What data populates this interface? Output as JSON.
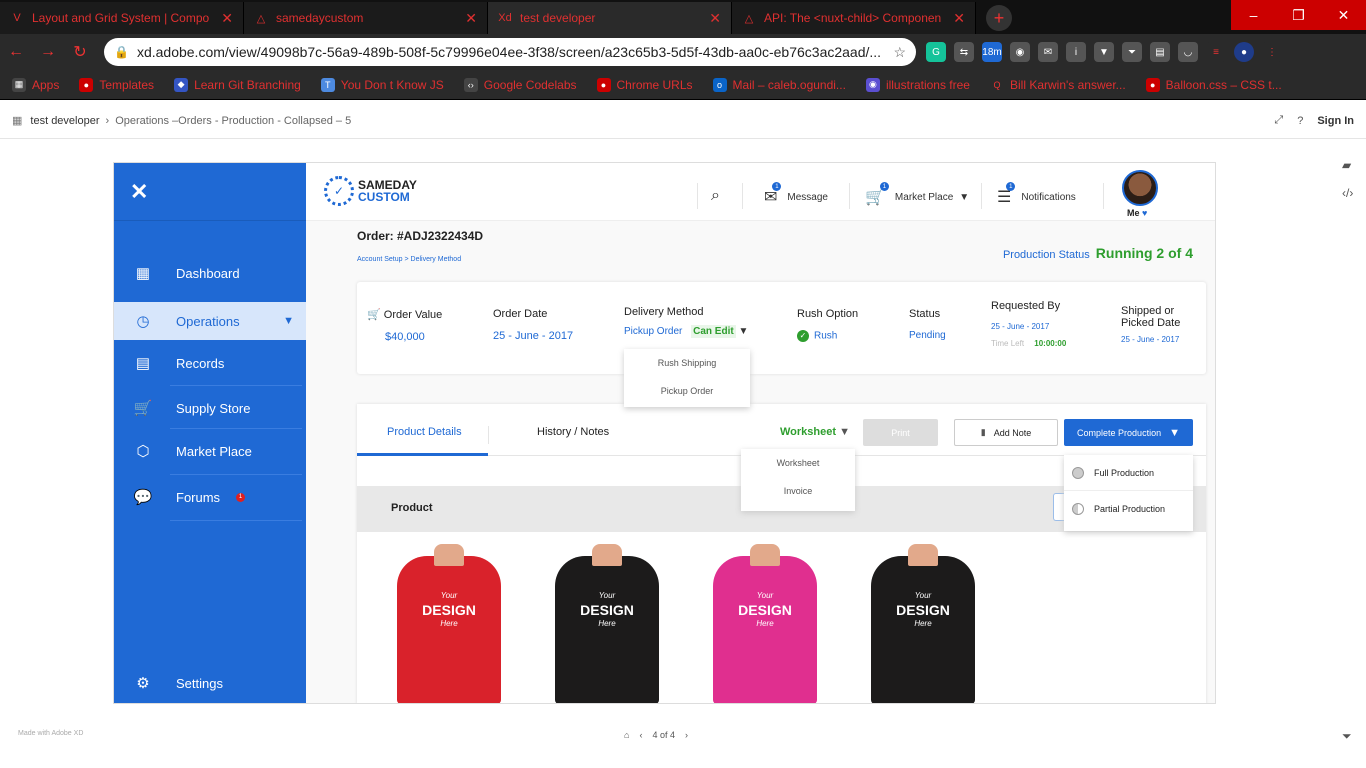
{
  "browser": {
    "tabs": [
      {
        "icon": "V",
        "title": "Layout and Grid System | Compo"
      },
      {
        "icon": "△",
        "title": "samedaycustom"
      },
      {
        "icon": "Xd",
        "title": "test developer"
      },
      {
        "icon": "△",
        "title": "API: The <nuxt-child> Componen"
      }
    ],
    "url": "xd.adobe.com/view/49098b7c-56a9-489b-508f-5c79996e04ee-3f38/screen/a23c65b3-5d5f-43db-aa0c-eb76c3ac2aad/...",
    "ext_badge": "18m",
    "bookmarks": [
      "Apps",
      "Templates",
      "Learn Git Branching",
      "You Don t Know JS",
      "Google Codelabs",
      "Chrome URLs",
      "Mail – caleb.ogundi...",
      "illustrations free",
      "Bill Karwin's answer...",
      "Balloon.css – CSS t..."
    ]
  },
  "xd": {
    "project": "test developer",
    "screen": "Operations –Orders - Production - Collapsed – 5",
    "signin": "Sign In",
    "made_with": "Made with Adobe XD",
    "page": "4 of 4"
  },
  "sidebar": {
    "items": [
      {
        "label": "Dashboard",
        "icon": "dashboard-icon"
      },
      {
        "label": "Operations",
        "icon": "clock-icon"
      },
      {
        "label": "Records",
        "icon": "records-icon"
      },
      {
        "label": "Supply Store",
        "icon": "cart-icon"
      },
      {
        "label": "Market Place",
        "icon": "cubes-icon"
      },
      {
        "label": "Forums",
        "icon": "chat-icon",
        "badge": "1"
      },
      {
        "label": "Settings",
        "icon": "gear-icon"
      }
    ]
  },
  "topbar": {
    "logo_line1": "SAMEDAY",
    "logo_line2": "CUSTOM",
    "message": "Message",
    "message_badge": "1",
    "marketplace": "Market Place",
    "marketplace_badge": "1",
    "notifications": "Notifications",
    "notifications_badge": "1",
    "me": "Me"
  },
  "order": {
    "number": "Order: #ADJ2322434D",
    "breadcrumb": "Account Setup > Delivery Method",
    "production_status_label": "Production Status",
    "production_status_value": "Running 2 of 4",
    "order_value_label": "Order Value",
    "order_value": "$40,000",
    "order_date_label": "Order Date",
    "order_date": "25 - June - 2017",
    "delivery_label": "Delivery Method",
    "delivery_value": "Pickup Order",
    "can_edit": "Can Edit",
    "delivery_options": [
      "Rush Shipping",
      "Pickup Order"
    ],
    "rush_label": "Rush Option",
    "rush_value": "Rush",
    "status_label": "Status",
    "status_value": "Pending",
    "requested_label": "Requested By",
    "requested_value": "25 - June - 2017",
    "time_left_label": "Time Left",
    "time_left_value": "10:00:00",
    "shipped_label_1": "Shipped or",
    "shipped_label_2": "Picked Date",
    "shipped_value": "25 - June - 2017"
  },
  "details": {
    "tab_product": "Product Details",
    "tab_history": "History / Notes",
    "worksheet": "Worksheet",
    "worksheet_options": [
      "Worksheet",
      "Invoice"
    ],
    "print": "Print",
    "add_note": "Add Note",
    "complete": "Complete Production",
    "complete_options": [
      "Full Production",
      "Partial Production"
    ],
    "product_header": "Product",
    "shirt_text_top": "Your",
    "shirt_text_mid": "DESIGN",
    "shirt_text_bottom": "Here",
    "shirt_colors": [
      "#d9222b",
      "#1c1b1b",
      "#e02f8f",
      "#1c1b1b"
    ]
  }
}
